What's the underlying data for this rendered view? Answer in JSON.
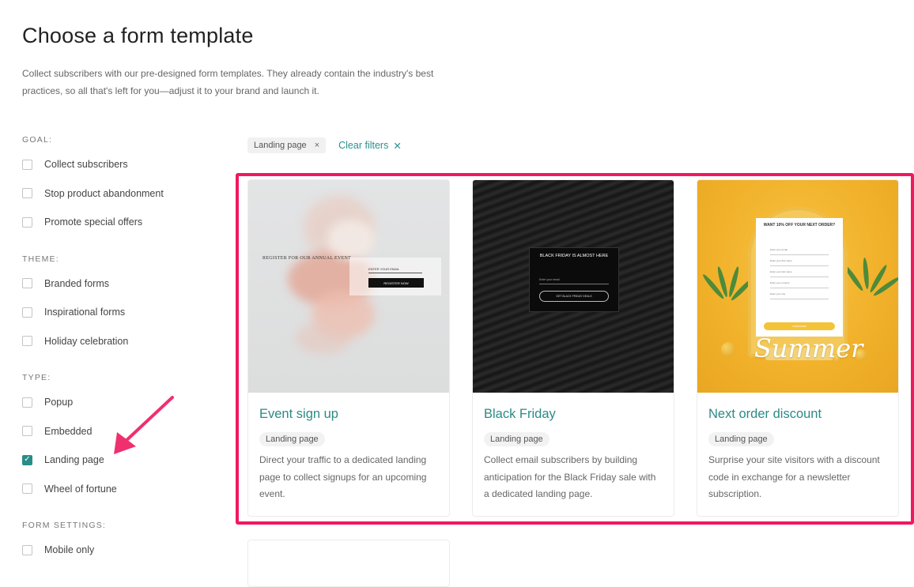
{
  "header": {
    "title": "Choose a form template",
    "description": "Collect subscribers with our pre-designed form templates. They already contain the industry's best practices, so all that's left for you—adjust it to your brand and launch it."
  },
  "filters": {
    "goal": {
      "title": "GOAL:",
      "options": [
        {
          "label": "Collect subscribers",
          "checked": false
        },
        {
          "label": "Stop product abandonment",
          "checked": false
        },
        {
          "label": "Promote special offers",
          "checked": false
        }
      ]
    },
    "theme": {
      "title": "THEME:",
      "options": [
        {
          "label": "Branded forms",
          "checked": false
        },
        {
          "label": "Inspirational forms",
          "checked": false
        },
        {
          "label": "Holiday celebration",
          "checked": false
        }
      ]
    },
    "type": {
      "title": "TYPE:",
      "options": [
        {
          "label": "Popup",
          "checked": false
        },
        {
          "label": "Embedded",
          "checked": false
        },
        {
          "label": "Landing page",
          "checked": true
        },
        {
          "label": "Wheel of fortune",
          "checked": false
        }
      ]
    },
    "form_settings": {
      "title": "FORM SETTINGS:",
      "options": [
        {
          "label": "Mobile only",
          "checked": false
        }
      ]
    }
  },
  "active_filters": {
    "chips": [
      {
        "label": "Landing page",
        "remove": "×"
      }
    ],
    "clear_label": "Clear filters",
    "clear_icon": "✕"
  },
  "templates": [
    {
      "title": "Event sign up",
      "tag": "Landing page",
      "description": "Direct your traffic to a dedicated landing page to collect signups for an upcoming event.",
      "preview": {
        "heading": "REGISTER FOR OUR ANNUAL EVENT",
        "field": "ENTER YOUR EMAIL",
        "button": "REGISTER NOW"
      }
    },
    {
      "title": "Black Friday",
      "tag": "Landing page",
      "description": "Collect email subscribers by building anticipation for the Black Friday sale with a dedicated landing page.",
      "preview": {
        "heading": "BLACK FRIDAY IS ALMOST HERE",
        "field": "Enter your email",
        "button": "GET BLACK FRIDAY DEALS"
      }
    },
    {
      "title": "Next order discount",
      "tag": "Landing page",
      "description": "Surprise your site visitors with a discount code in exchange for a newsletter subscription.",
      "preview": {
        "heading": "WANT 10% OFF YOUR NEXT ORDER?",
        "fields": [
          "Enter your email",
          "Enter your first name",
          "Enter your last name",
          "Enter your country",
          "Enter your city"
        ],
        "button": "SUBSCRIBE",
        "script_text": "Summer"
      }
    }
  ],
  "colors": {
    "accent": "#2a8d88",
    "highlight": "#f0185f"
  },
  "icons": {
    "checkmark": "✓"
  }
}
